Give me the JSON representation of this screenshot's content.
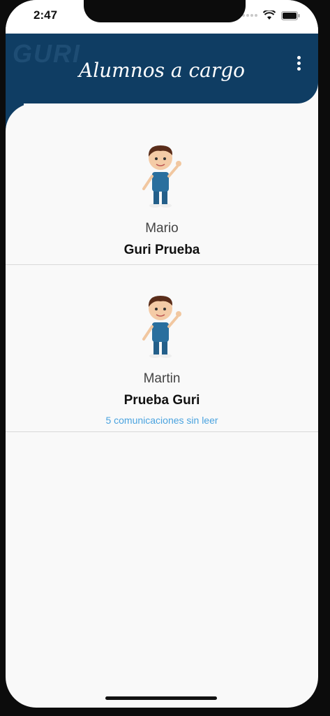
{
  "status_bar": {
    "time": "2:47"
  },
  "header": {
    "title": "Alumnos a cargo",
    "logo_text": "GURI",
    "menu_icon": "more-vertical-icon"
  },
  "students": [
    {
      "first_name": "Mario",
      "last_name": "Guri Prueba",
      "unread": ""
    },
    {
      "first_name": "Martin",
      "last_name": "Prueba Guri",
      "unread": "5 comunicaciones sin leer"
    }
  ],
  "colors": {
    "header": "#0f3d63",
    "unread": "#4aa3df",
    "background": "#f9f9f9"
  }
}
